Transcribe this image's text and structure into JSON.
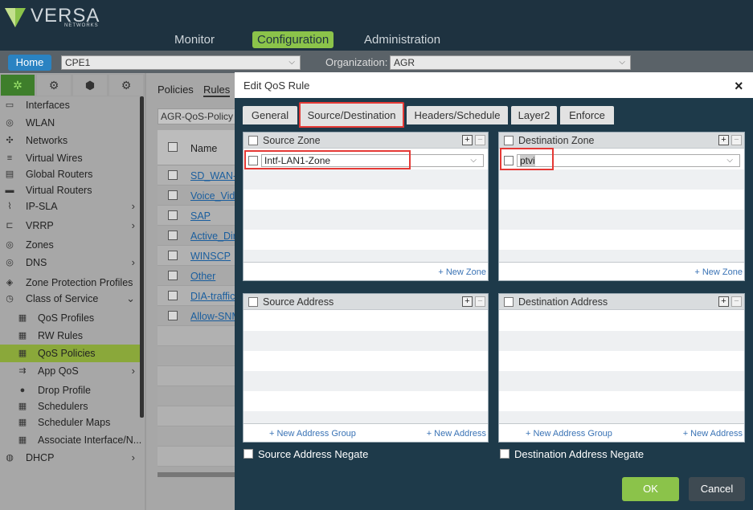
{
  "brand": {
    "name": "VERSA",
    "sub": "NETWORKS"
  },
  "nav": {
    "monitor": "Monitor",
    "configuration": "Configuration",
    "administration": "Administration"
  },
  "bar": {
    "home": "Home",
    "device": "CPE1",
    "org_label": "Organization:",
    "org": "AGR"
  },
  "sidebar": {
    "items": [
      {
        "label": "Interfaces",
        "icon": "interfaces-icon",
        "glyph": "▭"
      },
      {
        "label": "WLAN",
        "icon": "wlan-icon",
        "glyph": "◎"
      },
      {
        "label": "Networks",
        "icon": "networks-icon",
        "glyph": "✣"
      },
      {
        "label": "Virtual Wires",
        "icon": "virtual-wires-icon",
        "glyph": "≡"
      },
      {
        "label": "Global Routers",
        "icon": "global-routers-icon",
        "glyph": "▤"
      },
      {
        "label": "Virtual Routers",
        "icon": "virtual-routers-icon",
        "glyph": "▬"
      },
      {
        "label": "IP-SLA",
        "icon": "ip-sla-icon",
        "glyph": "⌇",
        "arrow": "›"
      },
      {
        "label": "VRRP",
        "icon": "vrrp-icon",
        "glyph": "⊏",
        "arrow": "›"
      },
      {
        "label": "Zones",
        "icon": "zones-icon",
        "glyph": "◎"
      },
      {
        "label": "DNS",
        "icon": "dns-icon",
        "glyph": "◎",
        "arrow": "›"
      },
      {
        "label": "Zone Protection Profiles",
        "icon": "zone-protection-icon",
        "glyph": "◈"
      },
      {
        "label": "Class of Service",
        "icon": "class-of-service-icon",
        "glyph": "◷",
        "arrow": "⌄"
      },
      {
        "label": "QoS Profiles",
        "icon": "qos-profiles-icon",
        "glyph": "▦",
        "sub": true
      },
      {
        "label": "RW Rules",
        "icon": "rw-rules-icon",
        "glyph": "▦",
        "sub": true
      },
      {
        "label": "QoS Policies",
        "icon": "qos-policies-icon",
        "glyph": "▦",
        "sub": true,
        "active": true
      },
      {
        "label": "App QoS",
        "icon": "app-qos-icon",
        "glyph": "⇉",
        "sub": true,
        "arrow": "›"
      },
      {
        "label": "Drop Profile",
        "icon": "drop-profile-icon",
        "glyph": "●",
        "sub": true
      },
      {
        "label": "Schedulers",
        "icon": "schedulers-icon",
        "glyph": "▦",
        "sub": true
      },
      {
        "label": "Scheduler Maps",
        "icon": "scheduler-maps-icon",
        "glyph": "▦",
        "sub": true
      },
      {
        "label": "Associate Interface/N...",
        "icon": "associate-interface-icon",
        "glyph": "▦",
        "sub": true
      },
      {
        "label": "DHCP",
        "icon": "dhcp-icon",
        "glyph": "◍",
        "arrow": "›"
      }
    ]
  },
  "mid": {
    "tabs": [
      "Policies",
      "Rules"
    ],
    "policy": "AGR-QoS-Policy",
    "col_name": "Name",
    "rows": [
      "SD_WAN-I",
      "Voice_Vide",
      "SAP",
      "Active_Dir",
      "WINSCP",
      "Other",
      "DIA-traffic",
      "Allow-SNM"
    ]
  },
  "modal": {
    "title": "Edit QoS Rule",
    "close": "×",
    "tabs": [
      "General",
      "Source/Destination",
      "Headers/Schedule",
      "Layer2",
      "Enforce"
    ],
    "source_zone": {
      "title": "Source Zone",
      "value": "Intf-LAN1-Zone",
      "new": "+ New Zone"
    },
    "destination_zone": {
      "title": "Destination Zone",
      "value": "ptvi",
      "new": "+ New Zone"
    },
    "source_address": {
      "title": "Source Address",
      "new_group": "+ New Address Group",
      "new": "+ New Address"
    },
    "destination_address": {
      "title": "Destination Address",
      "new_group": "+ New Address Group",
      "new": "+ New Address"
    },
    "src_negate": "Source Address Negate",
    "dst_negate": "Destination Address Negate",
    "ok": "OK",
    "cancel": "Cancel",
    "plus": "+",
    "minus": "−"
  }
}
